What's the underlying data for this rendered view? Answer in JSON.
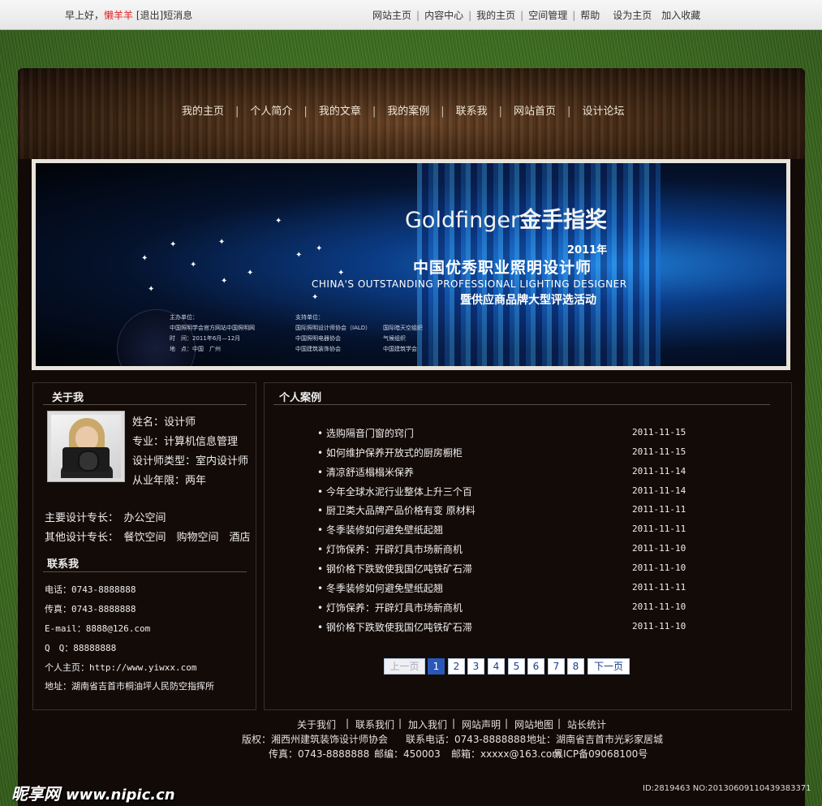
{
  "topbar": {
    "greeting": "早上好，",
    "username": "懒羊羊",
    "logout": "[退出]",
    "messages": "短消息",
    "links": [
      "网站主页",
      "内容中心",
      "我的主页",
      "空间管理",
      "帮助"
    ],
    "set_home": "设为主页",
    "add_favorite": "加入收藏"
  },
  "nav": {
    "items": [
      "我的主页",
      "个人简介",
      "我的文章",
      "我的案例",
      "联系我",
      "网站首页",
      "设计论坛"
    ]
  },
  "banner": {
    "brand": "Goldfinger",
    "brand_cn": "金手指奖",
    "year": "2011年",
    "title_cn": "中国优秀职业照明设计师",
    "title_en": "CHINA'S OUTSTANDING PROFESSIONAL LIGHTING DESIGNER",
    "subtitle_cn": "暨供应商品牌大型评选活动",
    "host_label": "主办单位：",
    "host_lines": [
      "中国照明学会官方网站中国照明网",
      "时　间：2011年6月—12月",
      "地　点：中国　广州"
    ],
    "support_label": "支持单位：",
    "support_col1": [
      "国际照明设计师协会（IALD）",
      "中国照明电器协会",
      "中国建筑装饰协会"
    ],
    "support_col2": [
      "国际暗天空组织",
      "气候组织",
      "中国建筑学会"
    ]
  },
  "about": {
    "title": "关于我",
    "name": "姓名：设计师",
    "major": "专业：计算机信息管理",
    "designer_type": "设计师类型：室内设计师",
    "years": "从业年限：两年",
    "main_specialty": "主要设计专长：　办公空间",
    "other_specialty": "其他设计专长：　餐饮空间　购物空间　酒店"
  },
  "contact": {
    "title": "联系我",
    "phone": "电话：0743-8888888",
    "fax": "传真：0743-8888888",
    "email": "E-mail：8888@126.com",
    "qq": "Q　Q：88888888",
    "homepage": "个人主页：http://www.yiwxx.com",
    "address": "地址：湖南省吉首市桐油坪人民防空指挥所"
  },
  "cases": {
    "title": "个人案例",
    "items": [
      {
        "title": "• 选购隔音门窗的窍门",
        "date": "2011-11-15"
      },
      {
        "title": "• 如何维护保养开放式的厨房橱柜",
        "date": "2011-11-15"
      },
      {
        "title": "• 清凉舒适榻榻米保养",
        "date": "2011-11-14"
      },
      {
        "title": "• 今年全球水泥行业整体上升三个百",
        "date": "2011-11-14"
      },
      {
        "title": "• 厨卫类大品牌产品价格有变 原材料",
        "date": "2011-11-11"
      },
      {
        "title": "• 冬季装修如何避免壁纸起翘",
        "date": "2011-11-11"
      },
      {
        "title": "• 灯饰保养：开辟灯具市场新商机",
        "date": "2011-11-10"
      },
      {
        "title": "• 钢价格下跌致使我国亿吨铁矿石滞",
        "date": "2011-11-10"
      },
      {
        "title": "• 冬季装修如何避免壁纸起翘",
        "date": "2011-11-11"
      },
      {
        "title": "• 灯饰保养：开辟灯具市场新商机",
        "date": "2011-11-10"
      },
      {
        "title": "• 钢价格下跌致使我国亿吨铁矿石滞",
        "date": "2011-11-10"
      }
    ],
    "pager": {
      "prev": "上一页",
      "pages": [
        "1",
        "2",
        "3",
        "4",
        "5",
        "6",
        "7",
        "8"
      ],
      "current": "1",
      "next": "下一页"
    }
  },
  "footer": {
    "links": [
      "关于我们",
      "联系我们",
      "加入我们",
      "网站声明",
      "网站地图",
      "站长统计"
    ],
    "copyright": "版权：湘西州建筑装饰设计师协会",
    "phone": "联系电话：0743-8888888",
    "address": "地址：湖南省吉首市光彩家居城",
    "fax": "传真：0743-8888888",
    "postcode": "邮编：450003",
    "email": "邮箱：xxxxx@163.com",
    "icp": "黑ICP备09068100号"
  },
  "watermark": {
    "brand": "昵享网",
    "url": "www.nipic.cn",
    "id": "ID:2819463 NO:20130609110439383371"
  }
}
